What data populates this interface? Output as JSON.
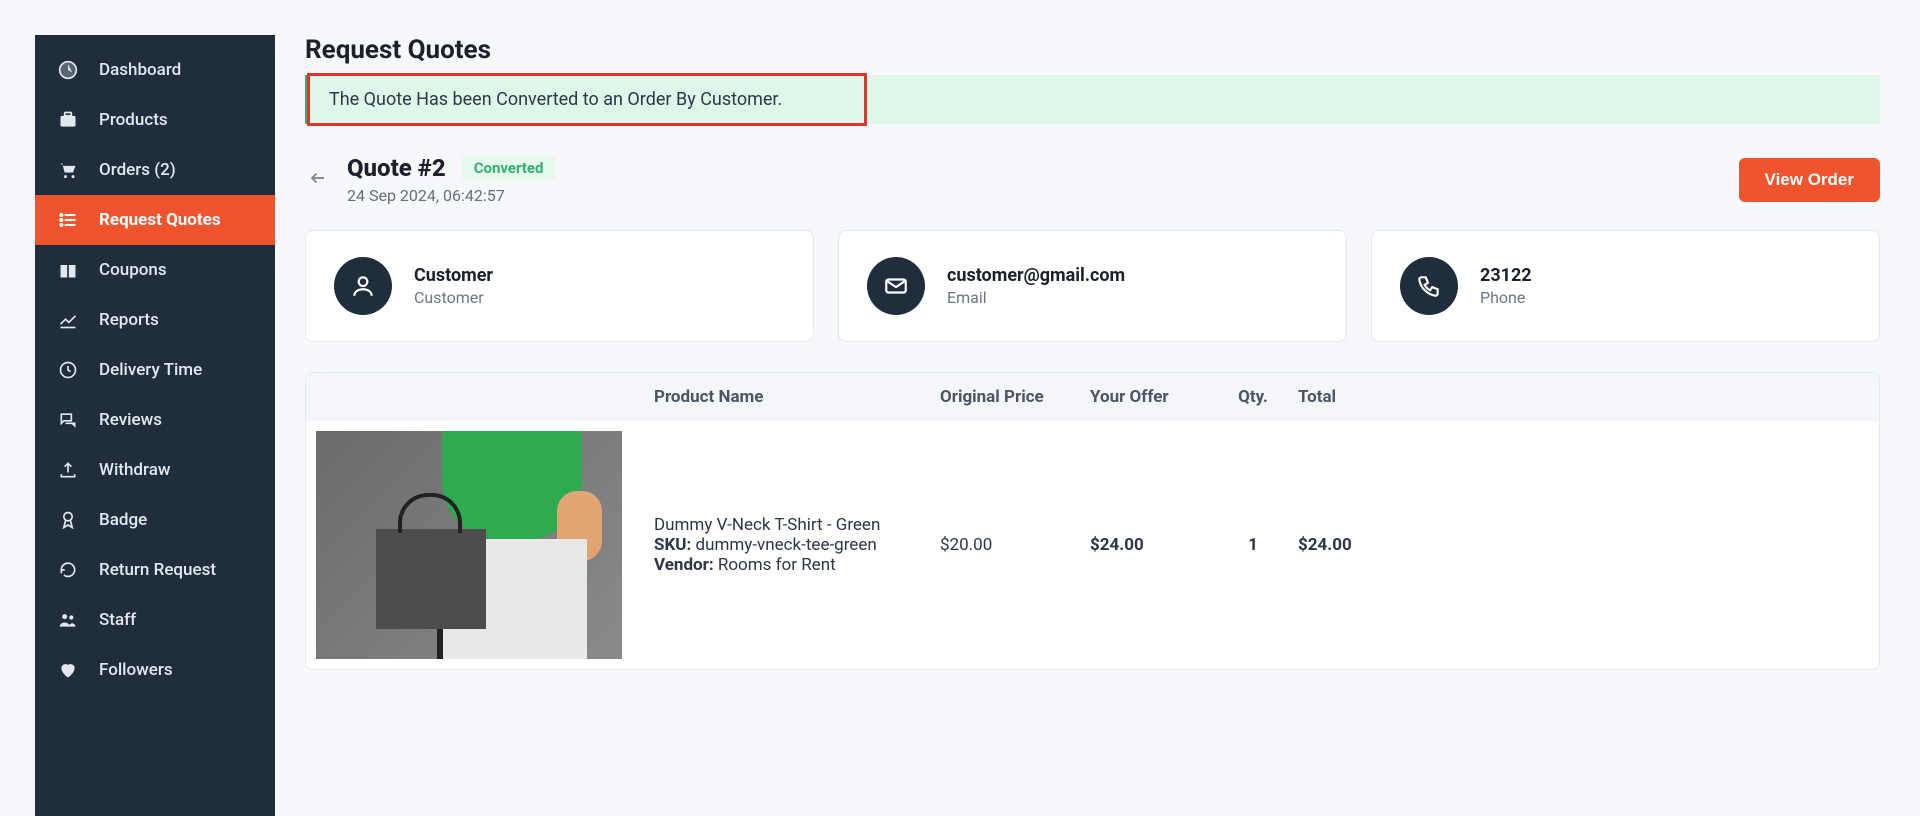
{
  "sidebar": {
    "items": [
      {
        "label": "Dashboard",
        "icon": "gauge-icon"
      },
      {
        "label": "Products",
        "icon": "briefcase-icon"
      },
      {
        "label": "Orders (2)",
        "icon": "cart-icon"
      },
      {
        "label": "Request Quotes",
        "icon": "list-icon",
        "active": true
      },
      {
        "label": "Coupons",
        "icon": "gift-icon"
      },
      {
        "label": "Reports",
        "icon": "chart-icon"
      },
      {
        "label": "Delivery Time",
        "icon": "clock-icon"
      },
      {
        "label": "Reviews",
        "icon": "comments-icon"
      },
      {
        "label": "Withdraw",
        "icon": "upload-icon"
      },
      {
        "label": "Badge",
        "icon": "badge-icon"
      },
      {
        "label": "Return Request",
        "icon": "undo-icon"
      },
      {
        "label": "Staff",
        "icon": "users-icon"
      },
      {
        "label": "Followers",
        "icon": "heart-icon"
      }
    ]
  },
  "page": {
    "title": "Request Quotes",
    "alert_text": "The Quote Has been Converted to an Order By Customer."
  },
  "quote": {
    "title": "Quote #2",
    "status_label": "Converted",
    "timestamp": "24 Sep 2024, 06:42:57",
    "view_order_label": "View Order"
  },
  "info": {
    "customer": {
      "primary": "Customer",
      "secondary": "Customer"
    },
    "email": {
      "primary": "customer@gmail.com",
      "secondary": "Email"
    },
    "phone": {
      "primary": "23122",
      "secondary": "Phone"
    }
  },
  "table": {
    "headers": {
      "name": "Product Name",
      "orig": "Original Price",
      "offer": "Your Offer",
      "qty": "Qty.",
      "total": "Total"
    },
    "rows": [
      {
        "name": "Dummy V-Neck T-Shirt - Green",
        "sku_label": "SKU:",
        "sku": "dummy-vneck-tee-green",
        "vendor_label": "Vendor:",
        "vendor": "Rooms for Rent",
        "orig": "$20.00",
        "offer": "$24.00",
        "qty": "1",
        "total": "$24.00"
      }
    ]
  }
}
